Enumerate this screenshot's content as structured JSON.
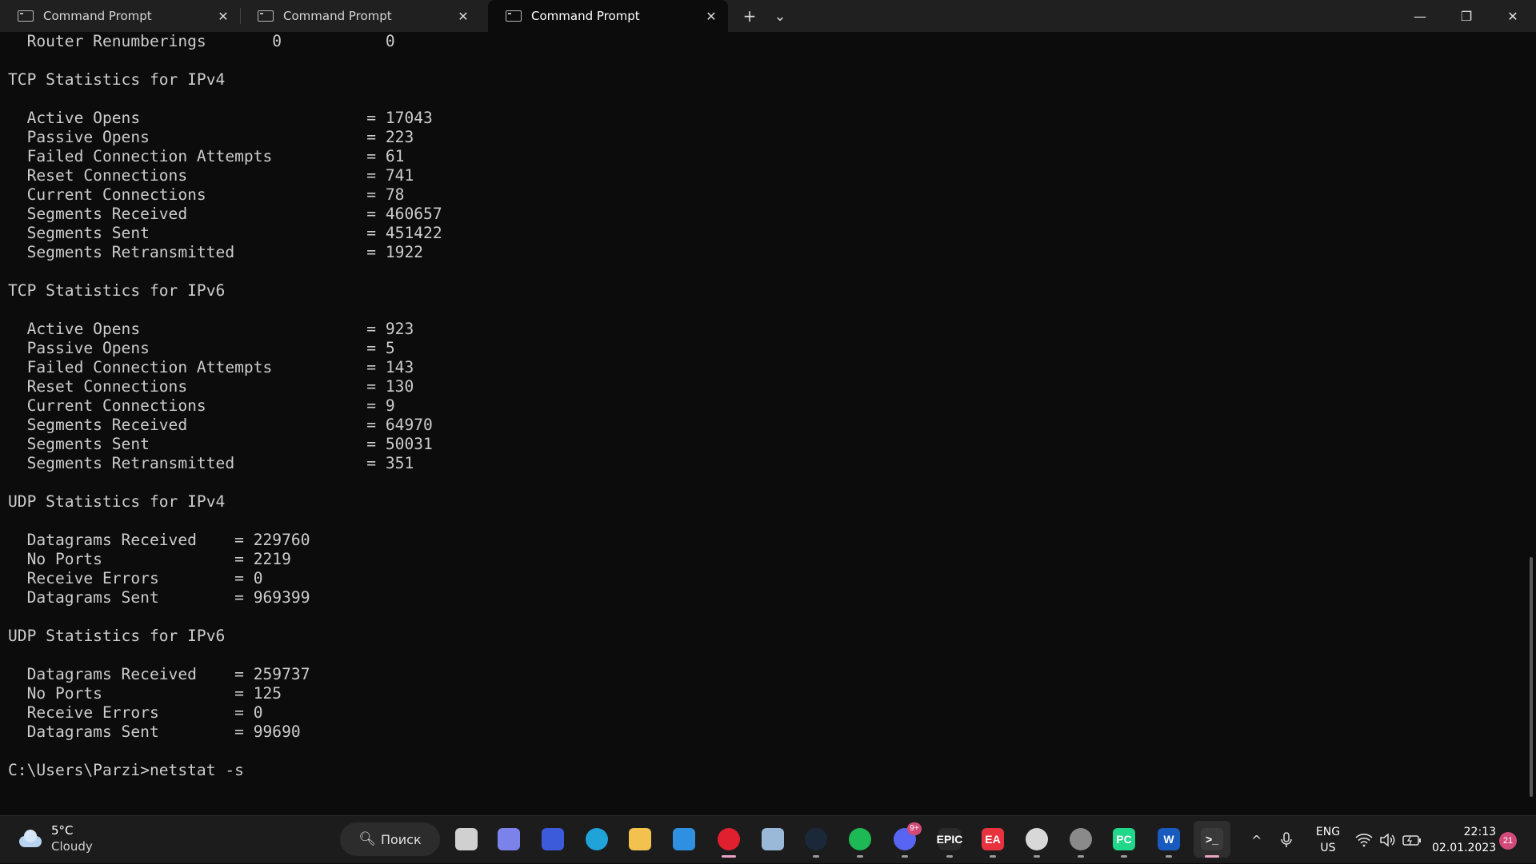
{
  "tabs": [
    {
      "label": "Command Prompt",
      "close": "✕"
    },
    {
      "label": "Command Prompt",
      "close": "✕"
    },
    {
      "label": "Command Prompt",
      "close": "✕"
    }
  ],
  "titlebar": {
    "new_tab": "+",
    "dropdown": "⌄"
  },
  "window_controls": {
    "minimize": "—",
    "restore": "❐",
    "close": "✕"
  },
  "terminal": {
    "lines": [
      "  Router Renumberings       0           0",
      "",
      "TCP Statistics for IPv4",
      "",
      "  Active Opens                        = 17043",
      "  Passive Opens                       = 223",
      "  Failed Connection Attempts          = 61",
      "  Reset Connections                   = 741",
      "  Current Connections                 = 78",
      "  Segments Received                   = 460657",
      "  Segments Sent                       = 451422",
      "  Segments Retransmitted              = 1922",
      "",
      "TCP Statistics for IPv6",
      "",
      "  Active Opens                        = 923",
      "  Passive Opens                       = 5",
      "  Failed Connection Attempts          = 143",
      "  Reset Connections                   = 130",
      "  Current Connections                 = 9",
      "  Segments Received                   = 64970",
      "  Segments Sent                       = 50031",
      "  Segments Retransmitted              = 351",
      "",
      "UDP Statistics for IPv4",
      "",
      "  Datagrams Received    = 229760",
      "  No Ports              = 2219",
      "  Receive Errors        = 0",
      "  Datagrams Sent        = 969399",
      "",
      "UDP Statistics for IPv6",
      "",
      "  Datagrams Received    = 259737",
      "  No Ports              = 125",
      "  Receive Errors        = 0",
      "  Datagrams Sent        = 99690",
      "",
      "C:\\Users\\Parzi>netstat -s"
    ]
  },
  "taskbar": {
    "weather": {
      "temp": "5°C",
      "condition": "Cloudy"
    },
    "search_label": "Поиск",
    "apps": [
      {
        "name": "windows-start",
        "label": "",
        "color": "#3aa0ff"
      },
      {
        "name": "task-view",
        "label": "",
        "color": "#d0d0d0"
      },
      {
        "name": "teams-chat",
        "label": "",
        "color": "#7b83eb"
      },
      {
        "name": "app-blue",
        "label": "",
        "color": "#3b5bdb"
      },
      {
        "name": "edge",
        "label": "",
        "color": "#1fa3d8"
      },
      {
        "name": "file-explorer",
        "label": "",
        "color": "#f2c14e"
      },
      {
        "name": "mail",
        "label": "",
        "color": "#2f8fe0"
      },
      {
        "name": "opera",
        "label": "",
        "color": "#e0202e"
      },
      {
        "name": "photos",
        "label": "",
        "color": "#9ab8d8"
      },
      {
        "name": "steam",
        "label": "",
        "color": "#1b2838"
      },
      {
        "name": "spotify",
        "label": "",
        "color": "#1db954"
      },
      {
        "name": "discord",
        "label": "",
        "color": "#5865f2",
        "badge": "9+"
      },
      {
        "name": "epic-games",
        "label": "EPIC",
        "color": "#2a2a2a"
      },
      {
        "name": "ea-app",
        "label": "EA",
        "color": "#e8333f"
      },
      {
        "name": "ubisoft",
        "label": "",
        "color": "#d8d8d8"
      },
      {
        "name": "settings",
        "label": "",
        "color": "#8a8a8a"
      },
      {
        "name": "pycharm",
        "label": "PC",
        "color": "#21d789"
      },
      {
        "name": "word",
        "label": "W",
        "color": "#185abd"
      },
      {
        "name": "terminal",
        "label": ">_",
        "color": "#3a3a3a"
      }
    ],
    "tray": {
      "overflow": "^",
      "lang_top": "ENG",
      "lang_bottom": "US",
      "time": "22:13",
      "date": "02.01.2023",
      "notifications": "21"
    }
  }
}
